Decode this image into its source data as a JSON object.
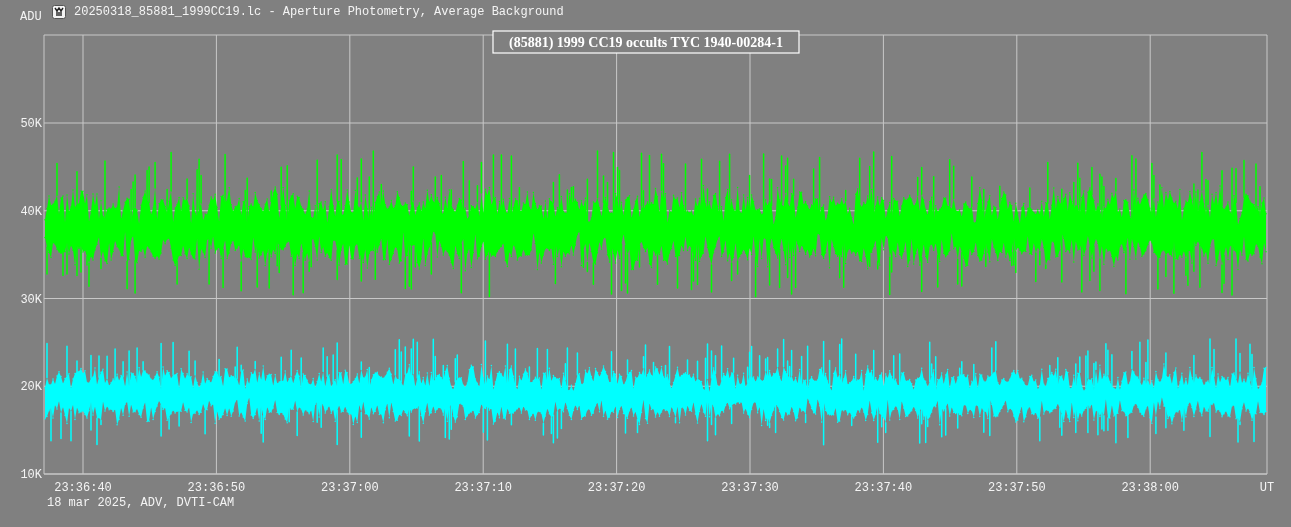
{
  "window": {
    "title": "20250318_85881_1999CC19.lc - Aperture Photometry, Average Background"
  },
  "chart": {
    "title": "(85881) 1999 CC19 occults TYC 1940-00284-1",
    "ylabel": "ADU",
    "yticks": [
      "50K",
      "40K",
      "30K",
      "20K",
      "10K"
    ],
    "xticks": [
      "23:36:40",
      "23:36:50",
      "23:37:00",
      "23:37:10",
      "23:37:20",
      "23:37:30",
      "23:37:40",
      "23:37:50",
      "23:38:00"
    ],
    "xunit": "UT",
    "series": [
      {
        "color": "#00ff00"
      },
      {
        "color": "#00ffff"
      }
    ]
  },
  "footer": "18 mar 2025, ADV, DVTI-CAM"
}
